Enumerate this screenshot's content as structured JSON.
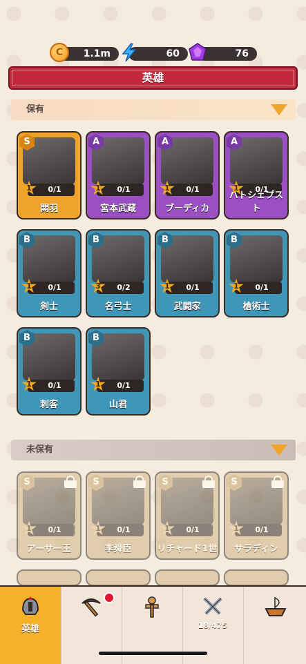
{
  "resources": {
    "coins": "1.1m",
    "energy": "60",
    "gems": "76"
  },
  "title": "英雄",
  "sections": {
    "owned": "保有",
    "unowned": "未保有"
  },
  "owned_heroes": [
    {
      "rank": "S",
      "level": "1",
      "progress": "0/1",
      "name": "関羽",
      "color": "#f0a32b"
    },
    {
      "rank": "A",
      "level": "1",
      "progress": "0/1",
      "name": "宮本武蔵",
      "color": "#9a4fc2"
    },
    {
      "rank": "A",
      "level": "1",
      "progress": "0/1",
      "name": "ブーディカ",
      "color": "#9a4fc2"
    },
    {
      "rank": "A",
      "level": "1",
      "progress": "0/1",
      "name": "ハトシェプスト",
      "color": "#9a4fc2"
    },
    {
      "rank": "B",
      "level": "1",
      "progress": "0/1",
      "name": "剣士",
      "color": "#3f96b6"
    },
    {
      "rank": "B",
      "level": "3",
      "progress": "0/2",
      "name": "名弓士",
      "color": "#3f96b6"
    },
    {
      "rank": "B",
      "level": "1",
      "progress": "0/1",
      "name": "武闘家",
      "color": "#3f96b6"
    },
    {
      "rank": "B",
      "level": "1",
      "progress": "0/1",
      "name": "槍術士",
      "color": "#3f96b6"
    },
    {
      "rank": "B",
      "level": "1",
      "progress": "0/1",
      "name": "刺客",
      "color": "#3f96b6"
    },
    {
      "rank": "B",
      "level": "1",
      "progress": "0/1",
      "name": "山君",
      "color": "#3f96b6"
    }
  ],
  "unowned_heroes": [
    {
      "rank": "S",
      "level": "1",
      "progress": "0/1",
      "name": "アーサー王"
    },
    {
      "rank": "S",
      "level": "1",
      "progress": "0/1",
      "name": "李舜臣"
    },
    {
      "rank": "S",
      "level": "1",
      "progress": "0/1",
      "name": "リチャード1世"
    },
    {
      "rank": "S",
      "level": "1",
      "progress": "0/1",
      "name": "サラディン"
    }
  ],
  "nav": {
    "heroes_label": "英雄",
    "equip_count": "18/475"
  }
}
